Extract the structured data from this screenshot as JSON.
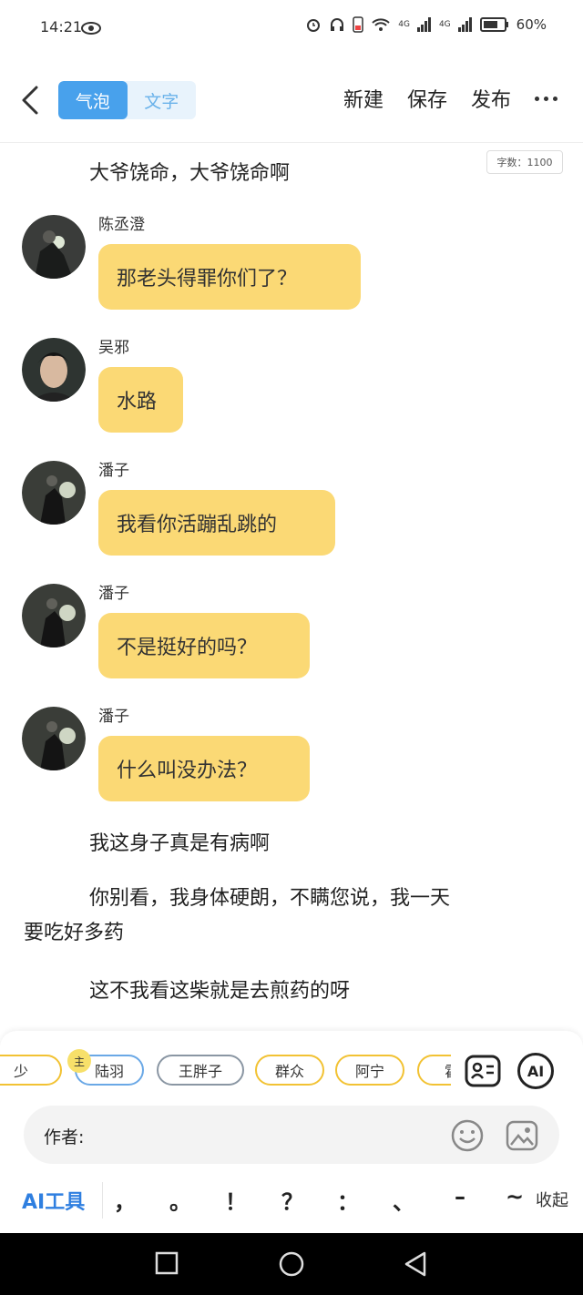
{
  "status_bar": {
    "time": "14:21",
    "network1": "4G",
    "network2": "4G",
    "battery": "60%"
  },
  "header": {
    "tabs": [
      "气泡",
      "文字"
    ],
    "actions": {
      "new": "新建",
      "save": "保存",
      "publish": "发布"
    }
  },
  "word_count": "字数：1100",
  "content": {
    "narration_top": "大爷饶命，大爷饶命啊",
    "messages": [
      {
        "speaker": "陈丞澄",
        "text": "那老头得罪你们了？"
      },
      {
        "speaker": "吴邪",
        "text": "水路"
      },
      {
        "speaker": "潘子",
        "text": "我看你活蹦乱跳的"
      },
      {
        "speaker": "潘子",
        "text": "不是挺好的吗？"
      },
      {
        "speaker": "潘子",
        "text": "什么叫没办法？"
      }
    ],
    "narration_bottom": [
      "我这身子真是有病啊",
      "你别看，我身体硬朗，不瞒您说，我一天",
      "要吃好多药",
      "这不我看这柴就是去煎药的呀"
    ]
  },
  "characters": {
    "chips": [
      "少",
      "陆羽",
      "王胖子",
      "群众",
      "阿宁",
      "霍"
    ],
    "main_badge": "主"
  },
  "author": {
    "label": "作者:",
    "value": ""
  },
  "toolbar": {
    "ai_tools": "AI工具",
    "ai_icon": "AI",
    "punctuation": [
      "，",
      "。",
      "！",
      "？",
      "：",
      "、",
      "–",
      "~"
    ],
    "collapse": "收起"
  },
  "colors": {
    "accent_blue": "#48a1ec",
    "bubble_yellow": "#fbd975"
  }
}
